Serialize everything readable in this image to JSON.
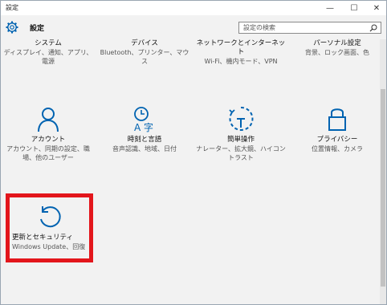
{
  "window": {
    "title": "設定",
    "min_glyph": "—",
    "max_glyph": "☐",
    "close_glyph": "✕"
  },
  "header": {
    "app_title": "設定",
    "search_placeholder": "設定の検索"
  },
  "row1": [
    {
      "label": "システム",
      "desc": "ディスプレイ、通知、アプリ、電源"
    },
    {
      "label": "デバイス",
      "desc": "Bluetooth、プリンター、マウス"
    },
    {
      "label": "ネットワークとインターネット",
      "desc": "Wi-Fi、機内モード、VPN"
    },
    {
      "label": "パーソナル設定",
      "desc": "背景、ロック画面、色"
    }
  ],
  "row2": [
    {
      "label": "アカウント",
      "desc": "アカウント、同期の設定、職場、他のユーザー",
      "icon": "person-icon"
    },
    {
      "label": "時刻と言語",
      "desc": "音声認識、地域、日付",
      "icon": "time-language-icon"
    },
    {
      "label": "簡単操作",
      "desc": "ナレーター、拡大鏡、ハイコントラスト",
      "icon": "ease-of-access-icon"
    },
    {
      "label": "プライバシー",
      "desc": "位置情報、カメラ",
      "icon": "lock-icon"
    }
  ],
  "row3": [
    {
      "label": "更新とセキュリティ",
      "desc": "Windows Update、回復",
      "icon": "update-icon"
    }
  ],
  "colors": {
    "accent": "#0063b1",
    "highlight": "#e3161c"
  }
}
